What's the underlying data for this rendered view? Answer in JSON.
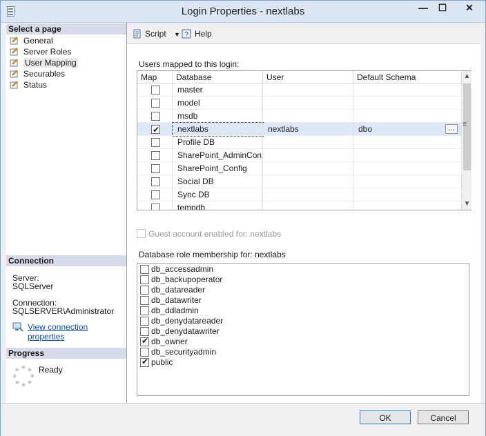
{
  "window": {
    "title": "Login Properties - nextlabs"
  },
  "left": {
    "select_header": "Select a page",
    "pages": [
      {
        "label": "General"
      },
      {
        "label": "Server Roles"
      },
      {
        "label": "User Mapping"
      },
      {
        "label": "Securables"
      },
      {
        "label": "Status"
      }
    ],
    "connection_header": "Connection",
    "server_label": "Server:",
    "server_value": "SQLServer",
    "connection_label": "Connection:",
    "connection_value": "SQLSERVER\\Administrator",
    "view_link": "View connection properties",
    "progress_header": "Progress",
    "progress_status": "Ready"
  },
  "toolbar": {
    "script_label": "Script",
    "help_label": "Help"
  },
  "mapping": {
    "title": "Users mapped to this login:",
    "columns": [
      "Map",
      "Database",
      "User",
      "Default Schema"
    ],
    "rows": [
      {
        "db": "master",
        "user": "",
        "schema": "",
        "checked": false
      },
      {
        "db": "model",
        "user": "",
        "schema": "",
        "checked": false
      },
      {
        "db": "msdb",
        "user": "",
        "schema": "",
        "checked": false
      },
      {
        "db": "nextlabs",
        "user": "nextlabs",
        "schema": "dbo",
        "checked": true
      },
      {
        "db": "Profile DB",
        "user": "",
        "schema": "",
        "checked": false
      },
      {
        "db": "SharePoint_AdminCon...",
        "user": "",
        "schema": "",
        "checked": false
      },
      {
        "db": "SharePoint_Config",
        "user": "",
        "schema": "",
        "checked": false
      },
      {
        "db": "Social DB",
        "user": "",
        "schema": "",
        "checked": false
      },
      {
        "db": "Sync DB",
        "user": "",
        "schema": "",
        "checked": false
      },
      {
        "db": "tempdb",
        "user": "",
        "schema": "",
        "checked": false
      }
    ],
    "ellipsis": "..."
  },
  "guest": {
    "label": "Guest account enabled for: nextlabs"
  },
  "roles": {
    "title": "Database role membership for: nextlabs",
    "items": [
      {
        "label": "db_accessadmin",
        "checked": false
      },
      {
        "label": "db_backupoperator",
        "checked": false
      },
      {
        "label": "db_datareader",
        "checked": false
      },
      {
        "label": "db_datawriter",
        "checked": false
      },
      {
        "label": "db_ddladmin",
        "checked": false
      },
      {
        "label": "db_denydatareader",
        "checked": false
      },
      {
        "label": "db_denydatawriter",
        "checked": false
      },
      {
        "label": "db_owner",
        "checked": true
      },
      {
        "label": "db_securityadmin",
        "checked": false
      },
      {
        "label": "public",
        "checked": true
      }
    ]
  },
  "buttons": {
    "ok": "OK",
    "cancel": "Cancel"
  }
}
